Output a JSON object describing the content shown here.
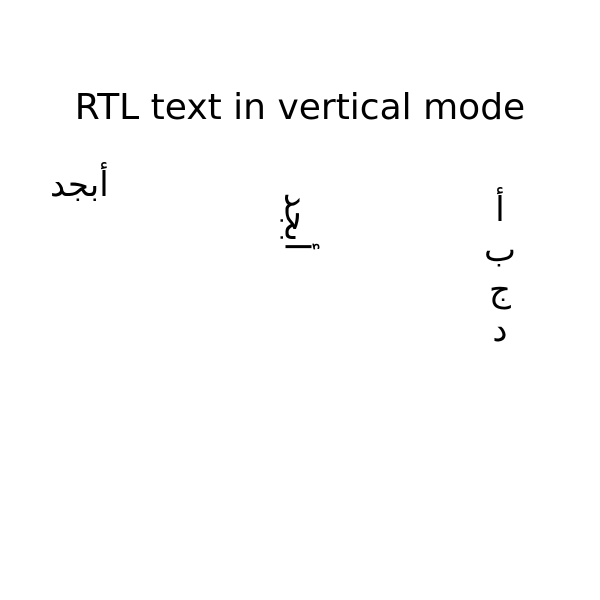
{
  "title": "RTL text in vertical mode",
  "samples": {
    "horizontal": "أبجد",
    "rotated": "أبجد",
    "stacked": [
      "أ",
      "ب",
      "ج",
      "د"
    ]
  }
}
